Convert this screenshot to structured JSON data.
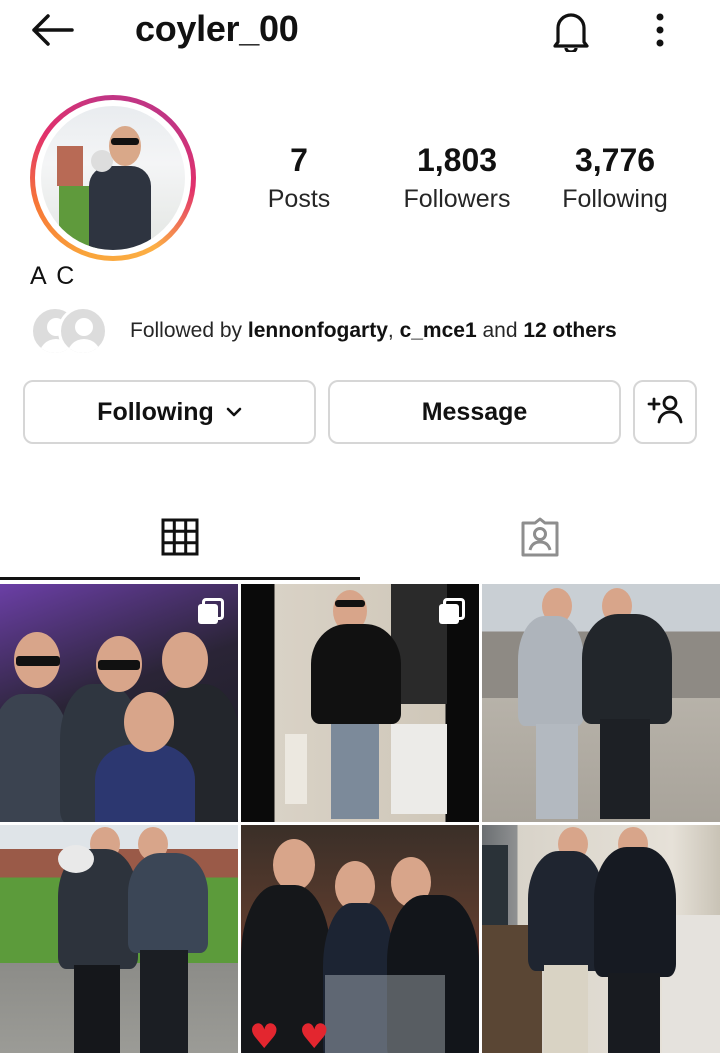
{
  "header": {
    "username": "coyler_00",
    "back_icon": "back-arrow-icon",
    "bell_icon": "bell-icon",
    "menu_icon": "kebab-menu-icon"
  },
  "profile": {
    "full_name": "A C",
    "posts_count": "7",
    "posts_label": "Posts",
    "followers_count": "1,803",
    "followers_label": "Followers",
    "following_count": "3,776",
    "following_label": "Following"
  },
  "followed_by": {
    "prefix": "Followed by ",
    "user1": "lennonfogarty",
    "sep": ", ",
    "user2": "c_mce1",
    "and": " and ",
    "others": "12 others"
  },
  "actions": {
    "following_label": "Following",
    "message_label": "Message",
    "add_user_icon": "add-user-icon"
  },
  "tabs": {
    "grid_icon": "grid-icon",
    "tagged_icon": "tagged-icon",
    "active": "grid"
  },
  "colors": {
    "story_ring": [
      "#f9a43a",
      "#e1306c",
      "#c13584"
    ],
    "border": "#d6d6d6"
  }
}
